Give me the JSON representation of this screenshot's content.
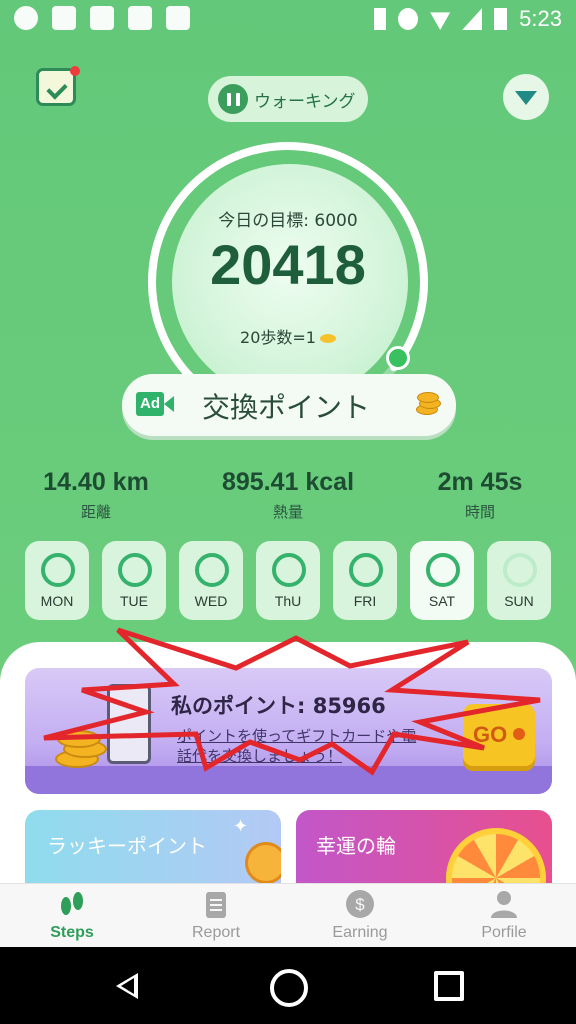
{
  "status_bar": {
    "time": "5:23"
  },
  "header": {
    "mode_label": "ウォーキング"
  },
  "progress": {
    "goal_text": "今日の目標: 6000",
    "steps": "20418",
    "rate_text": "20歩数=1",
    "ring_fraction": 0.78
  },
  "exchange": {
    "ad_label": "Ad",
    "label": "交換ポイント"
  },
  "stats": [
    {
      "value": "14.40 km",
      "label": "距離"
    },
    {
      "value": "895.41 kcal",
      "label": "熱量"
    },
    {
      "value": "2m 45s",
      "label": "時間"
    }
  ],
  "days": [
    "MON",
    "TUE",
    "WED",
    "ThU",
    "FRI",
    "SAT",
    "SUN"
  ],
  "points_card": {
    "title": "私のポイント: 85966",
    "subtitle": "ポイントを使ってギフトカードや電話代を交換しましょう！",
    "go_label": "GO"
  },
  "promos": {
    "lucky_label": "ラッキーポイント",
    "wheel_label": "幸運の輪"
  },
  "nav": [
    {
      "label": "Steps",
      "icon": "footsteps-icon",
      "active": true
    },
    {
      "label": "Report",
      "icon": "clipboard-icon",
      "active": false
    },
    {
      "label": "Earning",
      "icon": "dollar-coin-icon",
      "active": false
    },
    {
      "label": "Porfile",
      "icon": "person-icon",
      "active": false
    }
  ],
  "colors": {
    "accent": "#2f9e59",
    "background": "#6acb7c",
    "annotation": "#e3262b"
  }
}
